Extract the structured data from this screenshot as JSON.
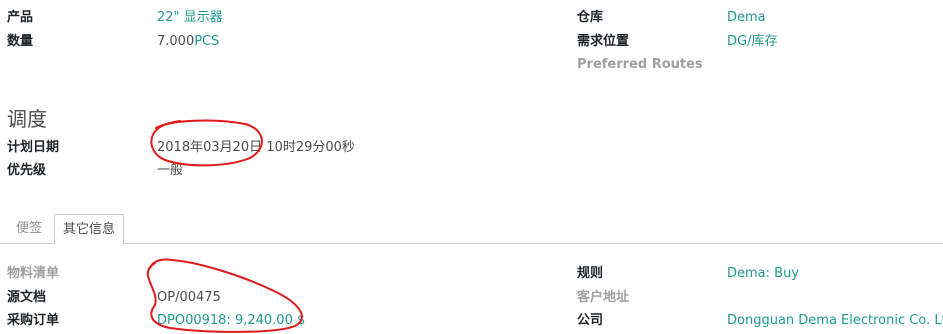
{
  "top": {
    "left": [
      {
        "label": "产品",
        "value": "22\" 显示器",
        "link": true
      },
      {
        "label": "数量",
        "value_num": "7.000",
        "value_unit": "PCS"
      }
    ],
    "right": [
      {
        "label": "仓库",
        "value": "Dema",
        "link": true
      },
      {
        "label": "需求位置",
        "value": "DG/库存",
        "link": true
      },
      {
        "label": "Preferred Routes",
        "value": ""
      }
    ]
  },
  "schedule": {
    "title": "调度",
    "rows": [
      {
        "label": "计划日期",
        "value": "2018年03月20日 10时29分00秒"
      },
      {
        "label": "优先级",
        "value": "一般"
      }
    ]
  },
  "tabs": [
    {
      "label": "便签",
      "active": false
    },
    {
      "label": "其它信息",
      "active": true
    }
  ],
  "other": {
    "left": [
      {
        "label": "物料清单",
        "value": ""
      },
      {
        "label": "源文档",
        "value": "OP/00475"
      },
      {
        "label": "采购订单",
        "value": "DPO00918: 9,240.00 $",
        "link": true
      }
    ],
    "right": [
      {
        "label": "规则",
        "value": "Dema: Buy",
        "link": true
      },
      {
        "label": "客户地址",
        "value": ""
      },
      {
        "label": "公司",
        "value": "Dongguan Dema Electronic Co. Ltd.",
        "link": true
      }
    ]
  },
  "colors": {
    "link": "#1f9a8d",
    "annotation": "#e0191b"
  }
}
